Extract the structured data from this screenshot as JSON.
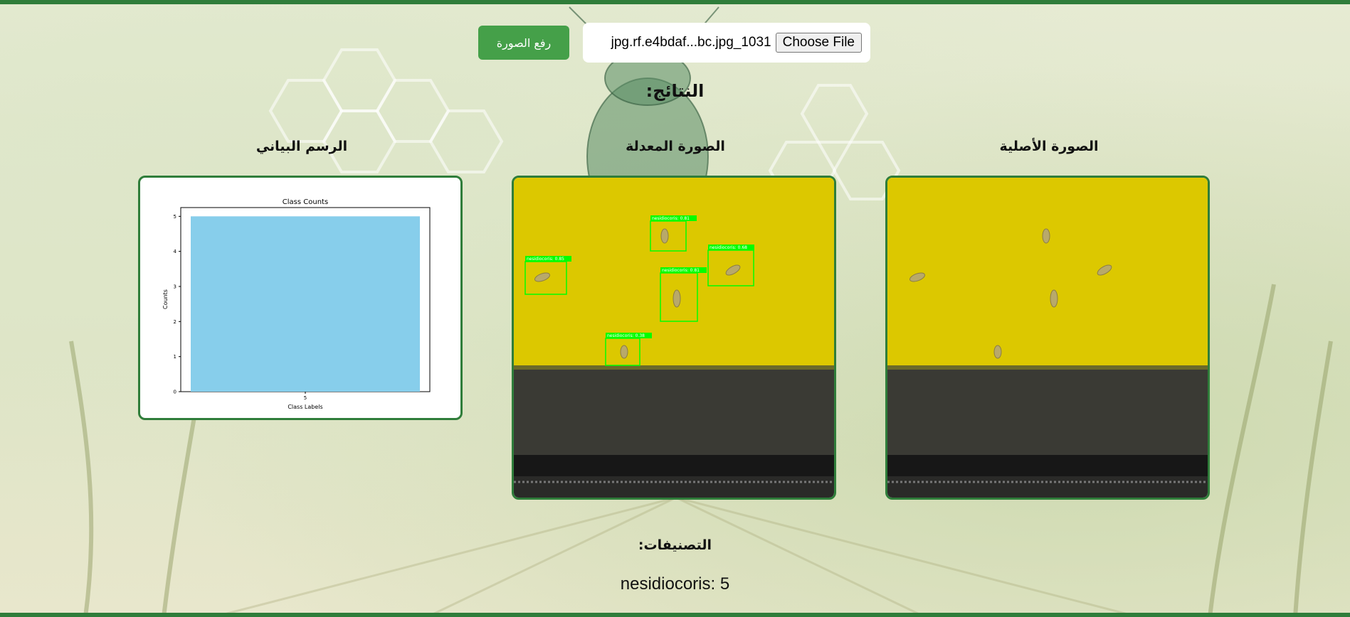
{
  "upload": {
    "button_label": "رفع الصورة",
    "file_name": "jpg.rf.e4bdaf...bc.jpg_1031",
    "choose_file_label": "Choose File"
  },
  "results_title": "النتائج:",
  "columns": {
    "chart_title": "الرسم البياني",
    "processed_title": "الصورة المعدلة",
    "original_title": "الصورة الأصلية"
  },
  "chart_data": {
    "type": "bar",
    "title": "Class Counts",
    "xlabel": "Class Labels",
    "ylabel": "Counts",
    "categories": [
      "5"
    ],
    "values": [
      5
    ],
    "ylim": [
      0,
      5.25
    ],
    "yticks": [
      "0",
      "1",
      "2",
      "3",
      "4",
      "5"
    ],
    "bar_color": "#87ceeb"
  },
  "detections": [
    {
      "label": "nesidiocoris: 0.81"
    },
    {
      "label": "nesidiocoris: 0.85"
    },
    {
      "label": "nesidiocoris: 0.68"
    },
    {
      "label": "nesidiocoris: 0.81"
    },
    {
      "label": "nesidiocoris: 0.38"
    }
  ],
  "classes_title": "التصنيفات:",
  "class_result": "nesidiocoris: 5",
  "colors": {
    "accent": "#2f7d3a",
    "button": "#45a049",
    "trap_yellow": "#dcc800",
    "box_green": "#00ff00"
  }
}
